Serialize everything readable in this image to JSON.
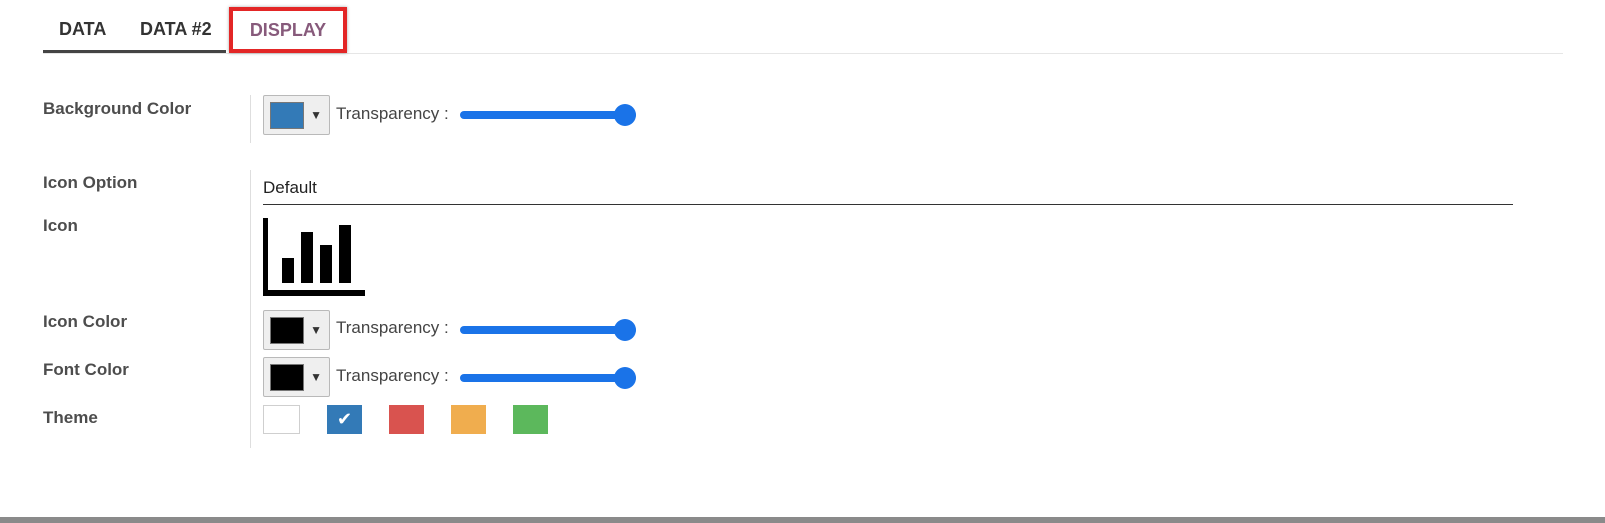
{
  "tabs": [
    {
      "label": "DATA"
    },
    {
      "label": "DATA #2"
    },
    {
      "label": "DISPLAY"
    }
  ],
  "fields": {
    "background_color": {
      "label": "Background Color",
      "color": "#337ab7",
      "transparency_label": "Transparency :",
      "transparency": 1.0
    },
    "icon_option": {
      "label": "Icon Option",
      "value": "Default"
    },
    "icon": {
      "label": "Icon",
      "icon_name": "bar-chart-icon"
    },
    "icon_color": {
      "label": "Icon Color",
      "color": "#000000",
      "transparency_label": "Transparency :",
      "transparency": 1.0
    },
    "font_color": {
      "label": "Font Color",
      "color": "#000000",
      "transparency_label": "Transparency :",
      "transparency": 1.0
    },
    "theme": {
      "label": "Theme",
      "selected_mark": "✔",
      "options": [
        {
          "name": "white",
          "color": "#ffffff"
        },
        {
          "name": "blue",
          "color": "#337ab7",
          "selected": true
        },
        {
          "name": "red",
          "color": "#d9534f"
        },
        {
          "name": "orange",
          "color": "#f0ad4e"
        },
        {
          "name": "green",
          "color": "#5cb85c"
        }
      ]
    }
  },
  "colors": {
    "accent": "#1a73e8",
    "active_tab": "#875a7b",
    "highlight_border": "#e32626"
  }
}
